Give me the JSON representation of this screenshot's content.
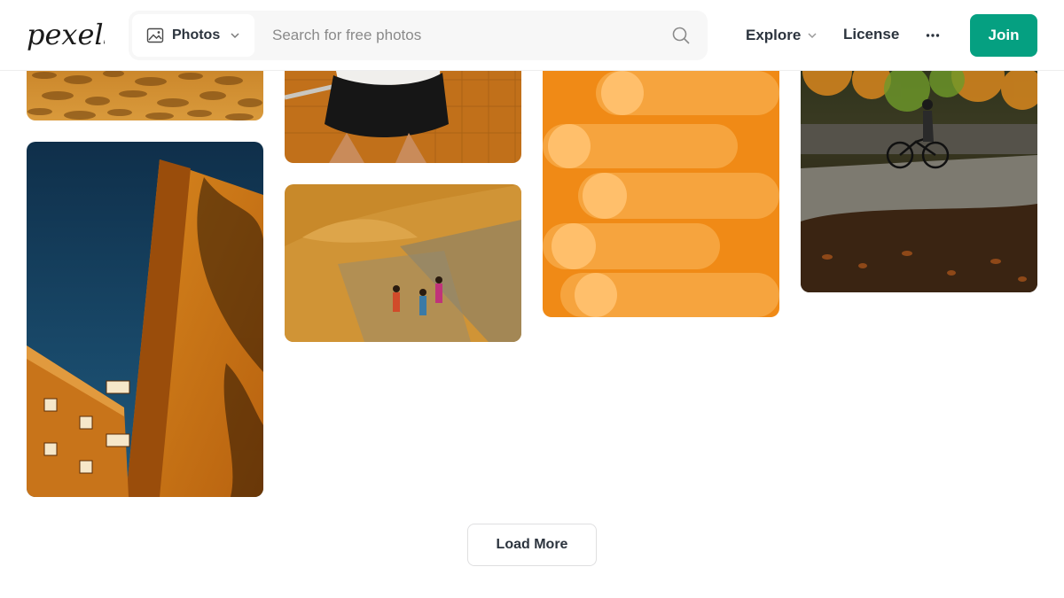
{
  "brand": {
    "logo_text": "pexels",
    "accent_color": "#05a081",
    "text_color": "#2c343e"
  },
  "header": {
    "media_type": {
      "selected": "Photos",
      "icon": "image-icon"
    },
    "search": {
      "placeholder": "Search for free photos",
      "value": "",
      "icon": "search-icon"
    },
    "nav": {
      "explore_label": "Explore",
      "license_label": "License",
      "more_icon": "more-dots-icon"
    },
    "join_label": "Join"
  },
  "gallery": {
    "photos": [
      {
        "id": "sand",
        "subject": "desert-sand-ripples"
      },
      {
        "id": "building",
        "subject": "orange-building-blue-sky"
      },
      {
        "id": "girl",
        "subject": "person-on-orange-tiled-stairs"
      },
      {
        "id": "field",
        "subject": "workers-on-grain-field"
      },
      {
        "id": "pipes",
        "subject": "orange-foam-tubes"
      },
      {
        "id": "bike",
        "subject": "cyclist-in-autumn-park"
      }
    ]
  },
  "footer": {
    "load_more_label": "Load More"
  }
}
